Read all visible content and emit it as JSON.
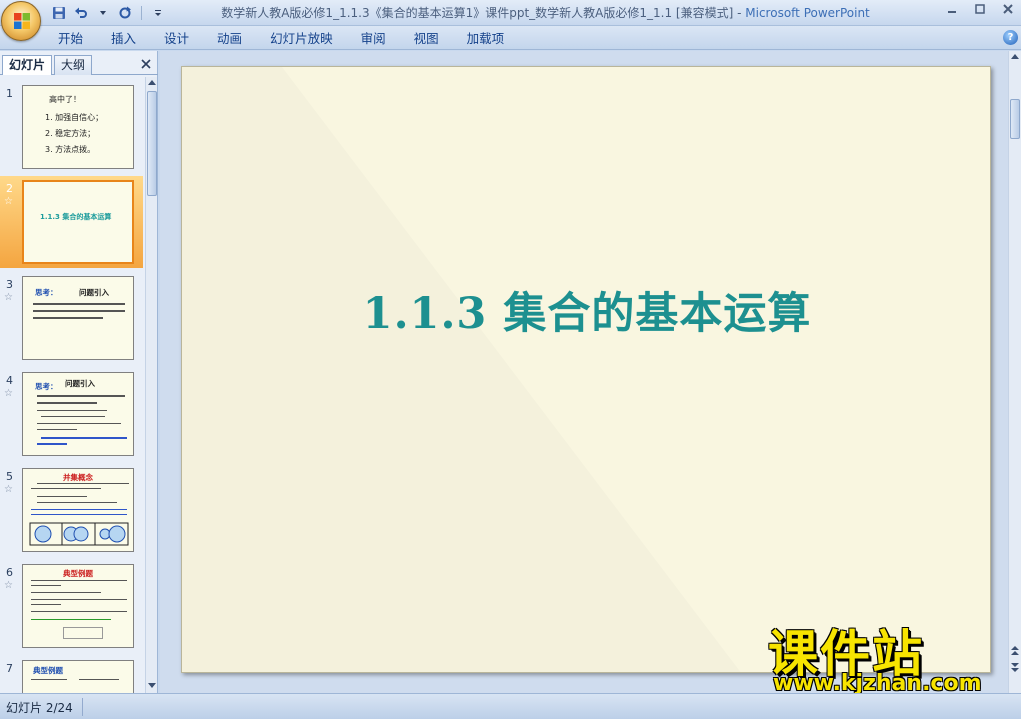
{
  "window": {
    "title": "数学新人教A版必修1_1.1.3《集合的基本运算1》课件ppt_数学新人教A版必修1_1.1 [兼容模式] -",
    "app_name": "Microsoft PowerPoint"
  },
  "ribbon": {
    "tabs": [
      "开始",
      "插入",
      "设计",
      "动画",
      "幻灯片放映",
      "审阅",
      "视图",
      "加载项"
    ]
  },
  "panel": {
    "tab_slides": "幻灯片",
    "tab_outline": "大纲"
  },
  "thumbnails": [
    {
      "num": "1",
      "lines": [
        "高中了！",
        "1. 加强自信心；",
        "2. 稳定方法；",
        "3. 方法点拨。"
      ]
    },
    {
      "num": "2",
      "title": "1.1.3 集合的基本运算"
    },
    {
      "num": "3",
      "heading": "思考：",
      "subheading": "问题引入"
    },
    {
      "num": "4",
      "heading": "思考：",
      "subheading": "问题引入"
    },
    {
      "num": "5",
      "heading": "并集概念"
    },
    {
      "num": "6",
      "heading": "典型例题"
    },
    {
      "num": "7",
      "heading": "典型例题"
    }
  ],
  "slide": {
    "title": "1.1.3  集合的基本运算"
  },
  "status": {
    "slide_counter": "幻灯片 2/24"
  },
  "watermark": {
    "text": "课件站",
    "url": "www.kjzhan.com"
  },
  "colors": {
    "slide_title": "#1d9090",
    "slide_bg": "#f9f6e0",
    "selected_thumb": "#f4a540"
  }
}
